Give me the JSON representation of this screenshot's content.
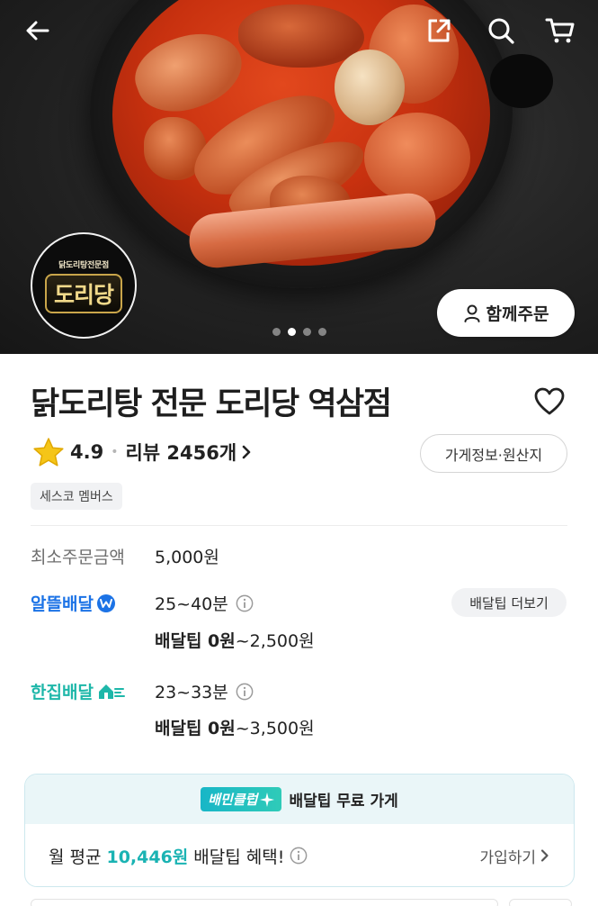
{
  "header": {
    "back_icon": "back-arrow-icon",
    "share_icon": "share-icon",
    "search_icon": "search-icon",
    "cart_icon": "cart-icon"
  },
  "hero": {
    "logo_subtitle": "닭도리탕전문점",
    "logo_title": "도리당",
    "group_order_label": "함께주문",
    "carousel_total": 4,
    "carousel_active": 2
  },
  "store": {
    "name": "닭도리탕 전문 도리당 역삼점",
    "rating": "4.9",
    "review_label": "리뷰 2456개",
    "info_button": "가게정보·원산지",
    "member_badge": "세스코 멤버스"
  },
  "order": {
    "min_order_label": "최소주문금액",
    "min_order_value": "5,000원"
  },
  "delivery": {
    "alddle": {
      "brand": "알뜰배달",
      "time": "25~40분",
      "tip_bold": "배달팁 0원",
      "tip_rest": "~2,500원"
    },
    "hanjip": {
      "brand": "한집배달",
      "time": "23~33분",
      "tip_bold": "배달팁 0원",
      "tip_rest": "~3,500원"
    },
    "tip_more_button": "배달팁 더보기"
  },
  "club": {
    "badge": "배민클럽",
    "headline": "배달팁 무료 가게",
    "avg_prefix": "월 평균",
    "avg_amount": "10,446원",
    "avg_suffix": "배달팁 혜택!",
    "join_label": "가입하기"
  },
  "colors": {
    "alddle_blue": "#1c73e6",
    "hanjip_teal": "#1eb7a9",
    "club_teal": "#1ab3b3",
    "star_yellow": "#f5c518"
  }
}
